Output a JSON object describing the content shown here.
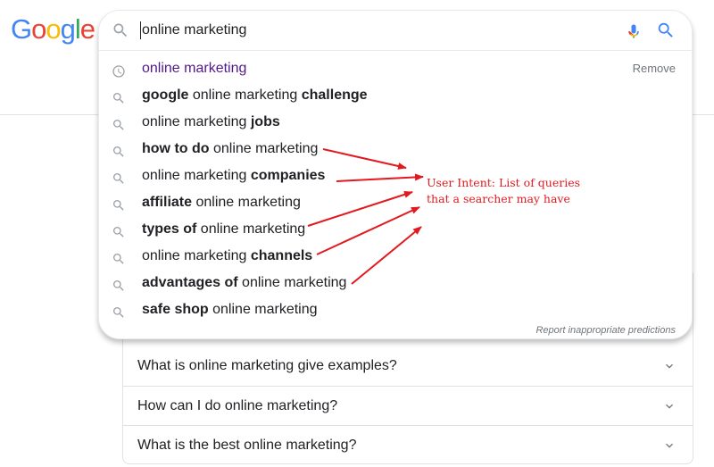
{
  "logo": {
    "letters": [
      "G",
      "o",
      "o",
      "g",
      "l",
      "e"
    ],
    "colors": [
      "#4285F4",
      "#EA4335",
      "#FBBC05",
      "#4285F4",
      "#34A853",
      "#EA4335"
    ]
  },
  "search": {
    "query": "online marketing",
    "icons": {
      "lead": "search-icon",
      "voice": "microphone-icon",
      "submit": "search-icon"
    }
  },
  "suggestions": [
    {
      "type": "history",
      "icon": "clock-icon",
      "parts": [
        {
          "t": "online marketing",
          "b": false
        }
      ],
      "action": "Remove"
    },
    {
      "type": "query",
      "icon": "search-icon",
      "parts": [
        {
          "t": "google",
          "b": true
        },
        {
          "t": " online marketing ",
          "b": false
        },
        {
          "t": "challenge",
          "b": true
        }
      ]
    },
    {
      "type": "query",
      "icon": "search-icon",
      "parts": [
        {
          "t": "online marketing ",
          "b": false
        },
        {
          "t": "jobs",
          "b": true
        }
      ]
    },
    {
      "type": "query",
      "icon": "search-icon",
      "parts": [
        {
          "t": "how to do",
          "b": true
        },
        {
          "t": " online marketing",
          "b": false
        }
      ]
    },
    {
      "type": "query",
      "icon": "search-icon",
      "parts": [
        {
          "t": "online marketing ",
          "b": false
        },
        {
          "t": "companies",
          "b": true
        }
      ]
    },
    {
      "type": "query",
      "icon": "search-icon",
      "parts": [
        {
          "t": "affiliate",
          "b": true
        },
        {
          "t": " online marketing",
          "b": false
        }
      ]
    },
    {
      "type": "query",
      "icon": "search-icon",
      "parts": [
        {
          "t": "types of",
          "b": true
        },
        {
          "t": " online marketing",
          "b": false
        }
      ]
    },
    {
      "type": "query",
      "icon": "search-icon",
      "parts": [
        {
          "t": "online marketing ",
          "b": false
        },
        {
          "t": "channels",
          "b": true
        }
      ]
    },
    {
      "type": "query",
      "icon": "search-icon",
      "parts": [
        {
          "t": "advantages of",
          "b": true
        },
        {
          "t": " online marketing",
          "b": false
        }
      ]
    },
    {
      "type": "query",
      "icon": "search-icon",
      "parts": [
        {
          "t": "safe shop",
          "b": true
        },
        {
          "t": " online marketing",
          "b": false
        }
      ]
    }
  ],
  "report_link": "Report inappropriate predictions",
  "annotation": {
    "line1": "User Intent: List of queries",
    "line2": "that a searcher may have",
    "color": "#e2191f"
  },
  "people_also_ask": [
    {
      "question": "What is online marketing give examples?",
      "icon": "chevron-down-icon"
    },
    {
      "question": "How can I do online marketing?",
      "icon": "chevron-down-icon"
    },
    {
      "question": "What is the best online marketing?",
      "icon": "chevron-down-icon"
    }
  ],
  "colors": {
    "accent_blue": "#4285F4",
    "history_purple": "#52188c",
    "muted_text": "#70757a",
    "annotation_red": "#e2191f"
  }
}
